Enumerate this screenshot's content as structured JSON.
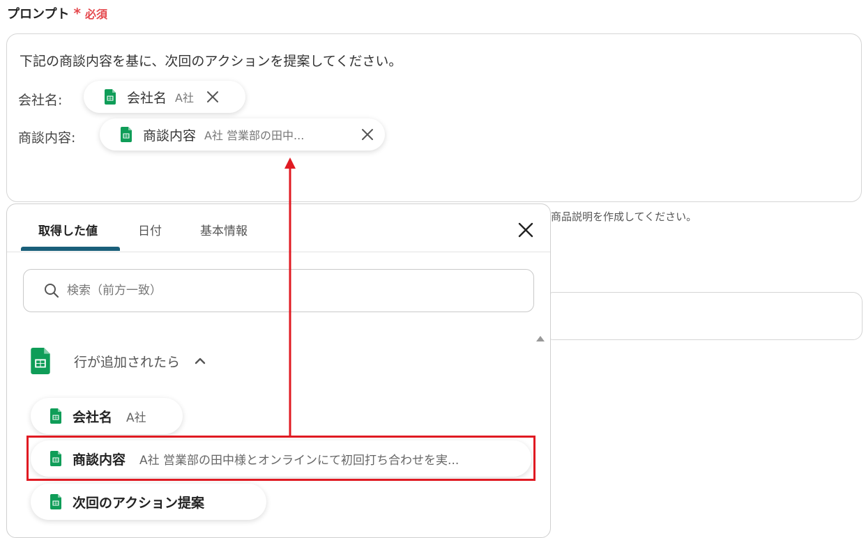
{
  "field": {
    "label": "プロンプト",
    "required_star": "*",
    "required_text": "必須"
  },
  "prompt": {
    "line1": "下記の商談内容を基に、次回のアクションを提案してください。",
    "row1_key": "会社名:",
    "row2_key": "商談内容:",
    "chip1": {
      "name": "会社名",
      "value": "A社"
    },
    "chip2": {
      "name": "商談内容",
      "value": "A社 営業部の田中..."
    }
  },
  "hint_text": "商品説明を作成してください。",
  "panel": {
    "tabs": [
      "取得した値",
      "日付",
      "基本情報"
    ],
    "active_tab": 0,
    "search_placeholder": "検索（前方一致）",
    "group_title": "行が追加されたら",
    "items": [
      {
        "name": "会社名",
        "value": "A社"
      },
      {
        "name": "商談内容",
        "value": "A社 営業部の田中様とオンラインにて初回打ち合わせを実..."
      },
      {
        "name": "次回のアクション提案",
        "value": ""
      }
    ]
  },
  "colors": {
    "required": "#e5484d",
    "tab_underline": "#1a5f7a",
    "sheets_green": "#0f9d58",
    "highlight": "#e01a22"
  },
  "icons": {
    "sheet": "google-sheets-icon",
    "close": "close-icon",
    "search": "search-icon",
    "chevron": "chevron-up-icon"
  }
}
